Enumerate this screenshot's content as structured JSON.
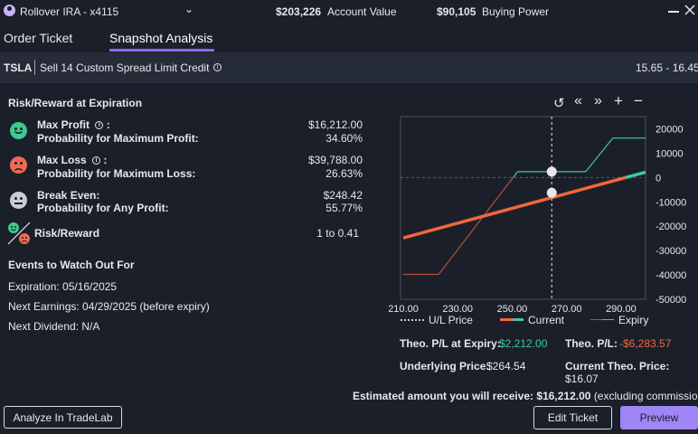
{
  "header": {
    "account_name": "Rollover IRA - x4115",
    "account_value": "$203,226",
    "account_value_label": "Account Value",
    "buying_power": "$90,105",
    "buying_power_label": "Buying Power"
  },
  "tabs": [
    {
      "label": "Order Ticket",
      "active": false
    },
    {
      "label": "Snapshot Analysis",
      "active": true
    }
  ],
  "order": {
    "symbol": "TSLA",
    "description": "Sell 14 Custom Spread Limit Credit",
    "price_range": "15.65 - 16.45"
  },
  "risk_reward": {
    "title": "Risk/Reward at Expiration",
    "max_profit_label": "Max Profit",
    "max_profit_value": "$16,212.00",
    "prob_max_profit_label": "Probability for Maximum Profit:",
    "prob_max_profit_value": "34.60%",
    "max_loss_label": "Max Loss",
    "max_loss_value": "$39,788.00",
    "prob_max_loss_label": "Probability for Maximum Loss:",
    "prob_max_loss_value": "26.63%",
    "break_even_label": "Break Even:",
    "break_even_value": "$248.42",
    "prob_any_profit_label": "Probability for Any Profit:",
    "prob_any_profit_value": "55.77%",
    "ratio_label": "Risk/Reward",
    "ratio_value": "1 to 0.41",
    "colon": ":"
  },
  "events": {
    "title": "Events to Watch Out For",
    "expiration": "Expiration: 05/16/2025",
    "earnings": "Next Earnings: 04/29/2025 (before expiry)",
    "dividend": "Next Dividend: N/A"
  },
  "chart_data": {
    "type": "line",
    "x_ticks": [
      "210.00",
      "230.00",
      "250.00",
      "270.00",
      "290.00"
    ],
    "y_ticks": [
      "20000",
      "10000",
      "0",
      "-10000",
      "-20000",
      "-30000",
      "-40000",
      "-50000"
    ],
    "xlim": [
      209,
      299
    ],
    "ylim": [
      -50000,
      25000
    ],
    "underlying_price": 264.54,
    "series": [
      {
        "name": "Current",
        "color": "#f0673a",
        "x": [
          210,
          299
        ],
        "y": [
          -24800,
          2200
        ]
      },
      {
        "name": "Expiry",
        "color": "#3fc9a0",
        "x": [
          210,
          223,
          252,
          262,
          277,
          287,
          299
        ],
        "y": [
          -39788,
          -39788,
          2400,
          2400,
          2400,
          16212,
          16212
        ]
      }
    ],
    "markers": [
      {
        "x": 264.54,
        "y": 2400
      },
      {
        "x": 264.54,
        "y": -6284
      }
    ],
    "legend": [
      "U/L Price",
      "Current",
      "Expiry"
    ]
  },
  "theo": {
    "pl_expiry_label": "Theo. P/L at Expiry:",
    "pl_expiry_value": "$2,212.00",
    "pl_label": "Theo. P/L:",
    "pl_value": "-$6,283.57",
    "underlying_label": "Underlying Price:",
    "underlying_value": "$264.54",
    "current_theo_label": "Current Theo. Price:",
    "current_theo_value": "$16.07",
    "estimate_prefix": "Estimated amount you will receive:",
    "estimate_value": "$16,212.00",
    "estimate_suffix": "(excluding commission)"
  },
  "buttons": {
    "analyze": "Analyze In TradeLab",
    "edit": "Edit Ticket",
    "preview": "Preview"
  },
  "colors": {
    "accent": "#9f85f5",
    "positive": "#3fc9a0",
    "negative": "#f0673a",
    "face_green": "#3ec98e",
    "face_red": "#f16a4f",
    "face_grey": "#c9ccd2"
  }
}
